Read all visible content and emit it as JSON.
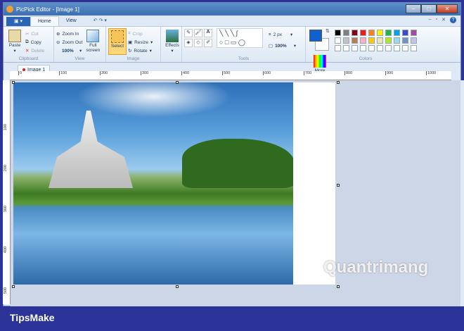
{
  "window": {
    "title": "PicPick Editor - [Image 1]",
    "min": "–",
    "max": "□",
    "close": "✕"
  },
  "tabs": [
    {
      "label": "Home"
    },
    {
      "label": "View"
    }
  ],
  "qat": {
    "undo": "↶",
    "redo": "↷",
    "more": "▾"
  },
  "tabright": {
    "min": "–",
    "restore": "▫",
    "close": "✕",
    "help": "?"
  },
  "ribbon": {
    "clipboard": {
      "label": "Clipboard",
      "paste": "Paste",
      "cut": "Cut",
      "copy": "Copy",
      "delete": "Delete"
    },
    "view": {
      "label": "View",
      "zoom_in": "Zoom In",
      "zoom_out": "Zoom Out",
      "zoom": "100%",
      "full": "Full screen"
    },
    "image": {
      "label": "Image",
      "select": "Select",
      "crop": "Crop",
      "resize": "Resize",
      "rotate": "Rotate"
    },
    "effects": {
      "label": "Effects"
    },
    "tools": {
      "label": "Tools",
      "width": "2 px",
      "opacity": "100%"
    },
    "colors": {
      "label": "Colors",
      "more": "More",
      "primary": "#1160d0",
      "secondary": "#ffffff",
      "palette": [
        "#000000",
        "#7f7f7f",
        "#880015",
        "#ed1c24",
        "#ff7f27",
        "#fff200",
        "#22b14c",
        "#00a2e8",
        "#3f48cc",
        "#a349a4",
        "#ffffff",
        "#c3c3c3",
        "#b97a57",
        "#ffaec9",
        "#ffc90e",
        "#efe4b0",
        "#b5e61d",
        "#99d9ea",
        "#7092be",
        "#c8bfe7",
        "#ffffff",
        "#ffffff",
        "#ffffff",
        "#ffffff",
        "#ffffff",
        "#ffffff",
        "#ffffff",
        "#ffffff",
        "#ffffff",
        "#ffffff"
      ]
    }
  },
  "document": {
    "tab": "Image 1"
  },
  "ruler": {
    "h": [
      "0",
      "100",
      "200",
      "300",
      "400",
      "500",
      "600",
      "700",
      "800",
      "900",
      "1000"
    ],
    "v": [
      "100",
      "200",
      "300",
      "400",
      "500"
    ]
  },
  "watermark": "Quantrimang",
  "footer": "TipsMake"
}
